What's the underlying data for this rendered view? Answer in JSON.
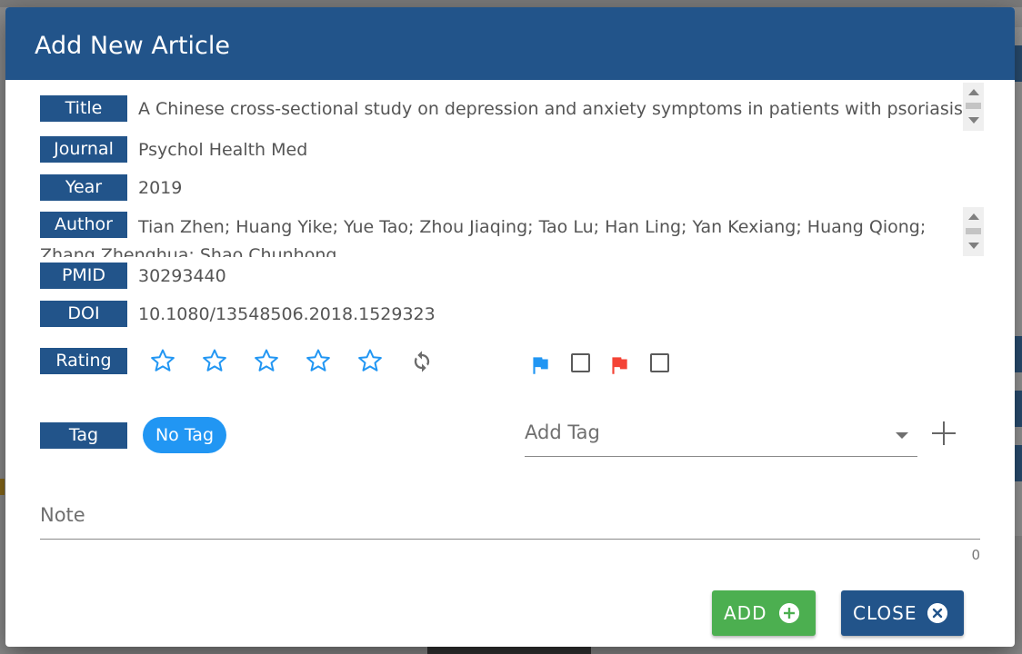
{
  "modal": {
    "title": "Add New Article"
  },
  "fields": {
    "title": {
      "label": "Title",
      "value": "A Chinese cross-sectional study on depression and anxiety symptoms in patients with psoriasis"
    },
    "journal": {
      "label": "Journal",
      "value": "Psychol Health Med"
    },
    "year": {
      "label": "Year",
      "value": "2019"
    },
    "author": {
      "label": "Author",
      "value": "Tian Zhen; Huang Yike; Yue Tao; Zhou Jiaqing; Tao Lu; Han Ling; Yan Kexiang; Huang Qiong; Zhang Zhenghua; Shao Chunhong"
    },
    "pmid": {
      "label": "PMID",
      "value": "30293440"
    },
    "doi": {
      "label": "DOI",
      "value": "10.1080/13548506.2018.1529323"
    }
  },
  "rating": {
    "label": "Rating",
    "stars_selected": 0,
    "stars_total": 5
  },
  "flags": [
    {
      "icon": "flag-icon",
      "color": "#2196f3",
      "checked": false
    },
    {
      "icon": "flag-icon",
      "color": "#f44336",
      "checked": false
    }
  ],
  "tags": {
    "label": "Tag",
    "chip": "No Tag",
    "add_placeholder": "Add Tag"
  },
  "note": {
    "placeholder": "Note",
    "counter": "0"
  },
  "buttons": {
    "add": "ADD",
    "close": "CLOSE"
  },
  "colors": {
    "header": "#22548a",
    "add_button": "#4caf50",
    "chip": "#2196f3",
    "star": "#2196f3"
  }
}
